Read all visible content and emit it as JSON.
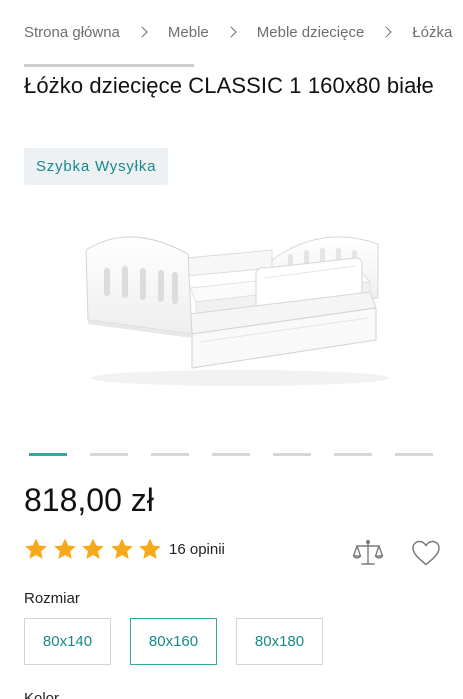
{
  "breadcrumb": {
    "items": [
      "Strona główna",
      "Meble",
      "Meble dziecięce",
      "Łóżka"
    ]
  },
  "product": {
    "title": "Łóżko dziecięce CLASSIC 1 160x80 białe",
    "badge": "Szybka Wysyłka",
    "price": "818,00 zł",
    "rating": 5,
    "reviews": "16 opinii"
  },
  "gallery": {
    "image_count": 7,
    "active_index": 0
  },
  "size": {
    "label": "Rozmiar",
    "options": [
      "80x140",
      "80x160",
      "80x180"
    ],
    "selected": "80x160"
  },
  "next_section_label": "Kolor",
  "colors": {
    "accent": "#35a89c",
    "accent_text": "#17898a",
    "star": "#f7a91a",
    "badge_bg": "#eef1f4"
  },
  "icons": {
    "breadcrumb_separator": "chevron-right-icon",
    "compare": "scales-icon",
    "wishlist": "heart-icon",
    "rating": "star-icon"
  }
}
